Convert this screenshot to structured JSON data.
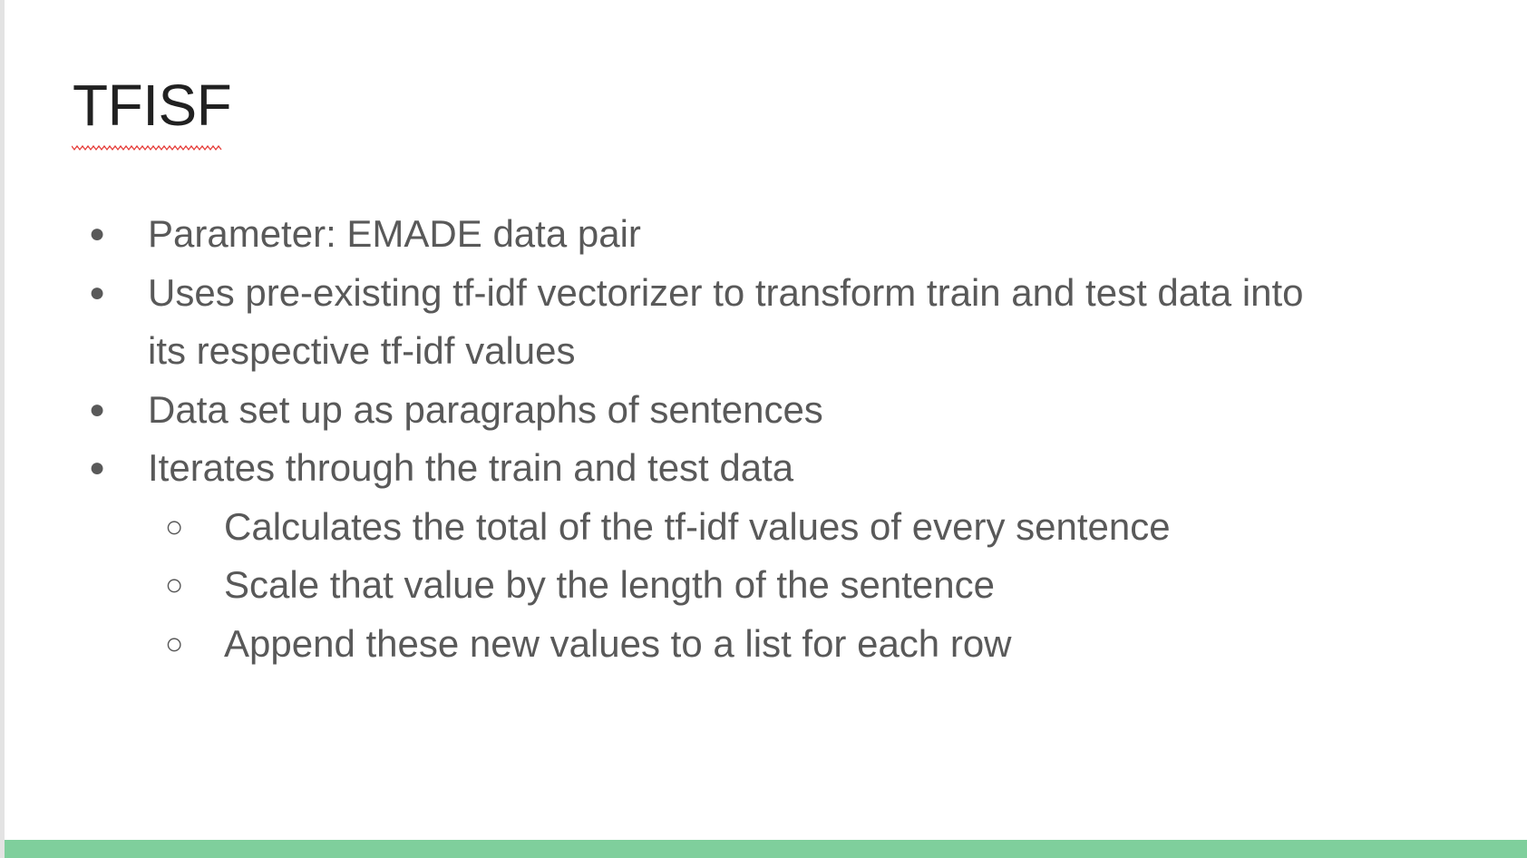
{
  "slide": {
    "title": "TFISF",
    "bullets": [
      {
        "level": 1,
        "marker": "●",
        "text": "Parameter: EMADE data pair"
      },
      {
        "level": 1,
        "marker": "●",
        "text": "Uses pre-existing tf-idf vectorizer to transform train and test data into"
      },
      {
        "level": 1,
        "marker": "",
        "text": "its respective tf-idf values"
      },
      {
        "level": 1,
        "marker": "●",
        "text": "Data set up as paragraphs of sentences"
      },
      {
        "level": 1,
        "marker": "●",
        "text": "Iterates through the train and test data"
      },
      {
        "level": 2,
        "marker": "○",
        "text": "Calculates the total of the tf-idf values of every sentence"
      },
      {
        "level": 2,
        "marker": "○",
        "text": "Scale that value by the length of the sentence"
      },
      {
        "level": 2,
        "marker": "○",
        "text": "Append these new values to a list for each row"
      }
    ]
  },
  "colors": {
    "title": "#212121",
    "body_text": "#595959",
    "accent_bar": "#7fcf9c",
    "spellcheck_underline": "#e53935"
  }
}
